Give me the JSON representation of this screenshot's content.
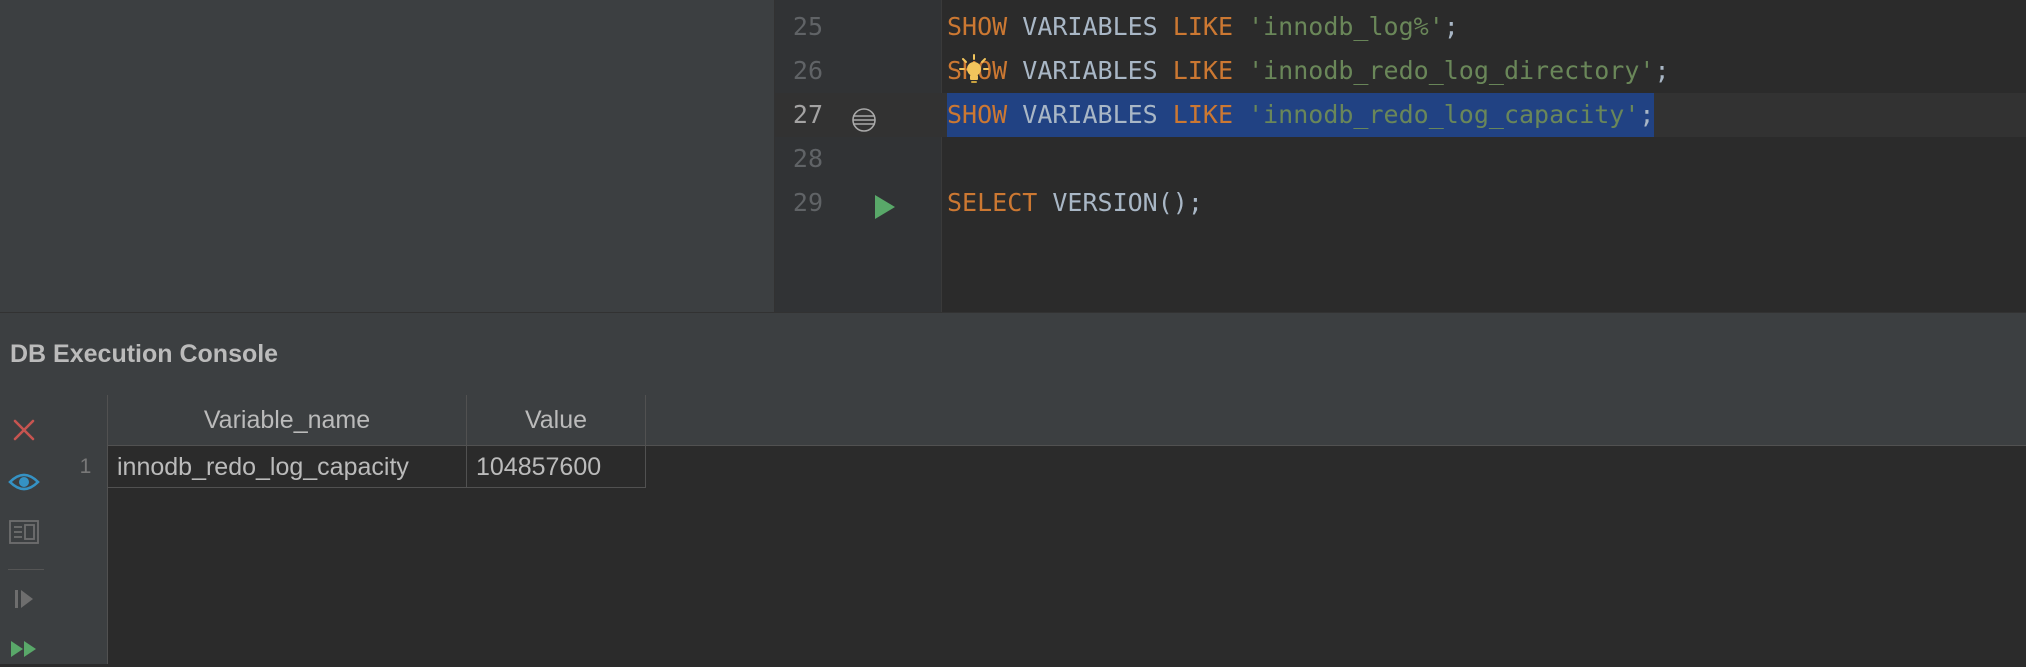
{
  "editor": {
    "lines": [
      {
        "number": "25",
        "tokens": [
          {
            "t": "SHOW",
            "c": "kw"
          },
          {
            "t": " VARIABLES ",
            "c": "pl"
          },
          {
            "t": "LIKE",
            "c": "kw"
          },
          {
            "t": " ",
            "c": "pl"
          },
          {
            "t": "'innodb_log%'",
            "c": "str"
          },
          {
            "t": ";",
            "c": "pl"
          }
        ]
      },
      {
        "number": "26",
        "tokens": [
          {
            "t": "SHOW",
            "c": "kw"
          },
          {
            "t": " VARIABLES ",
            "c": "pl"
          },
          {
            "t": "LIKE",
            "c": "kw"
          },
          {
            "t": " ",
            "c": "pl"
          },
          {
            "t": "'innodb_redo_log_directory'",
            "c": "str"
          },
          {
            "t": ";",
            "c": "pl"
          }
        ]
      },
      {
        "number": "27",
        "current": true,
        "selected": true,
        "tokens": [
          {
            "t": "SHOW",
            "c": "kw"
          },
          {
            "t": " VARIABLES ",
            "c": "pl"
          },
          {
            "t": "LIKE",
            "c": "kw"
          },
          {
            "t": " ",
            "c": "pl"
          },
          {
            "t": "'innodb_redo_log_capacity'",
            "c": "str"
          },
          {
            "t": ";",
            "c": "pl"
          }
        ]
      },
      {
        "number": "28",
        "tokens": []
      },
      {
        "number": "29",
        "tokens": [
          {
            "t": "SELECT",
            "c": "kw"
          },
          {
            "t": " VERSION();",
            "c": "pl"
          }
        ]
      }
    ],
    "gutter_icons": {
      "line27": "statement-marker-icon",
      "line29": "run-statement-icon",
      "line26": "intention-bulb-icon"
    }
  },
  "console": {
    "title": "DB Execution Console",
    "toolbar": [
      "close-icon",
      "eye-icon",
      "layout-icon",
      "resume-icon",
      "fast-forward-icon"
    ],
    "colors": {
      "close": "#c75450",
      "eye": "#3592c4",
      "run": "#59a869"
    }
  },
  "results": {
    "columns": [
      "Variable_name",
      "Value"
    ],
    "rows": [
      {
        "num": "1",
        "cells": [
          "innodb_redo_log_capacity",
          "104857600"
        ]
      }
    ]
  }
}
